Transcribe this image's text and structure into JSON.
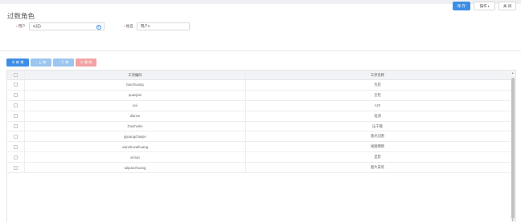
{
  "header": {
    "save_label": "保 存",
    "ops_label": "操作",
    "close_label": "关 闭"
  },
  "page": {
    "title": "过数角色"
  },
  "form": {
    "user_label": "用户",
    "user_value": "1(记)",
    "name_label": "姓名",
    "name_value": "用户1"
  },
  "toolbar": {
    "add": "⊕ 新 增",
    "up": "↑ 上 移",
    "down": "↓ 下 移",
    "delete": "⊖ 删 除"
  },
  "table": {
    "headers": {
      "code": "工序编码",
      "name": "工序名称"
    },
    "rows": [
      {
        "code": "baozhuang",
        "name": "包装"
      },
      {
        "code": "quanjian",
        "name": "全检"
      },
      {
        "code": "aoi",
        "name": "AOI"
      },
      {
        "code": "diance",
        "name": "电测"
      },
      {
        "code": "zhazheike",
        "name": "压干膜"
      },
      {
        "code": "jiguangchanjie",
        "name": "激光切割"
      },
      {
        "code": "xianshuzaihuang",
        "name": "线路曝晒"
      },
      {
        "code": "xinran",
        "name": "显影"
      },
      {
        "code": "tulpianzhuang",
        "name": "图片安装"
      }
    ]
  }
}
